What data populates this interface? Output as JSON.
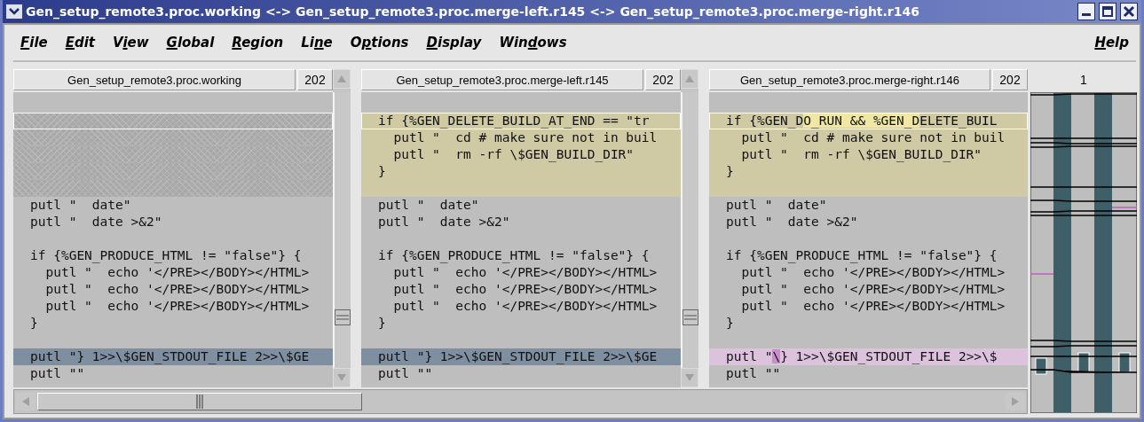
{
  "window": {
    "title": "Gen_setup_remote3.proc.working <-> Gen_setup_remote3.proc.merge-left.r145 <-> Gen_setup_remote3.proc.merge-right.r146"
  },
  "menu": [
    {
      "parts": [
        {
          "text": "F",
          "underlined": true
        },
        {
          "text": "ile",
          "underlined": false
        }
      ]
    },
    {
      "parts": [
        {
          "text": "E",
          "underlined": true
        },
        {
          "text": "dit",
          "underlined": false
        }
      ]
    },
    {
      "parts": [
        {
          "text": "V",
          "underlined": false
        },
        {
          "text": "i",
          "underlined": true
        },
        {
          "text": "ew",
          "underlined": false
        }
      ]
    },
    {
      "parts": [
        {
          "text": "G",
          "underlined": true
        },
        {
          "text": "lobal",
          "underlined": false
        }
      ]
    },
    {
      "parts": [
        {
          "text": "R",
          "underlined": true
        },
        {
          "text": "egion",
          "underlined": false
        }
      ]
    },
    {
      "parts": [
        {
          "text": "Li",
          "underlined": false
        },
        {
          "text": "n",
          "underlined": true
        },
        {
          "text": "e",
          "underlined": false
        }
      ]
    },
    {
      "parts": [
        {
          "text": "O",
          "underlined": false
        },
        {
          "text": "p",
          "underlined": true
        },
        {
          "text": "tions",
          "underlined": false
        }
      ]
    },
    {
      "parts": [
        {
          "text": "D",
          "underlined": true
        },
        {
          "text": "isplay",
          "underlined": false
        }
      ]
    },
    {
      "parts": [
        {
          "text": "Win",
          "underlined": false
        },
        {
          "text": "d",
          "underlined": true
        },
        {
          "text": "ows",
          "underlined": false
        }
      ]
    }
  ],
  "help_menu": {
    "parts": [
      {
        "text": "H",
        "underlined": true
      },
      {
        "text": "elp",
        "underlined": false
      }
    ]
  },
  "panes": [
    {
      "file": "Gen_setup_remote3.proc.working",
      "line_count": "202",
      "lines": [
        {
          "kind": "plain"
        },
        {
          "kind": "missing",
          "current": true
        },
        {
          "kind": "missing"
        },
        {
          "kind": "missing"
        },
        {
          "kind": "missing"
        },
        {
          "kind": "missing"
        },
        {
          "kind": "plain",
          "text": "putl \"  date\""
        },
        {
          "kind": "plain",
          "text": "putl \"  date >&2\""
        },
        {
          "kind": "plain"
        },
        {
          "kind": "plain",
          "text": "if {%GEN_PRODUCE_HTML != \"false\"} {"
        },
        {
          "kind": "plain",
          "text": "  putl \"  echo '</PRE></BODY></HTML>"
        },
        {
          "kind": "plain",
          "text": "  putl \"  echo '</PRE></BODY></HTML>"
        },
        {
          "kind": "plain",
          "text": "  putl \"  echo '</PRE></BODY></HTML>"
        },
        {
          "kind": "plain",
          "text": "}"
        },
        {
          "kind": "plain"
        },
        {
          "kind": "diff",
          "text": "putl \"} 1>>\\$GEN_STDOUT_FILE 2>>\\$GE"
        },
        {
          "kind": "plain",
          "text": "putl \"\""
        }
      ]
    },
    {
      "file": "Gen_setup_remote3.proc.merge-left.r145",
      "line_count": "202",
      "lines": [
        {
          "kind": "plain"
        },
        {
          "kind": "changed",
          "current": true,
          "text": "if {%GEN_DELETE_BUILD_AT_END == \"tr"
        },
        {
          "kind": "changed",
          "text": "  putl \"  cd # make sure not in buil"
        },
        {
          "kind": "changed",
          "text": "  putl \"  rm -rf \\$GEN_BUILD_DIR\""
        },
        {
          "kind": "changed",
          "text": "}"
        },
        {
          "kind": "changed"
        },
        {
          "kind": "plain",
          "text": "putl \"  date\""
        },
        {
          "kind": "plain",
          "text": "putl \"  date >&2\""
        },
        {
          "kind": "plain"
        },
        {
          "kind": "plain",
          "text": "if {%GEN_PRODUCE_HTML != \"false\"} {"
        },
        {
          "kind": "plain",
          "text": "  putl \"  echo '</PRE></BODY></HTML>"
        },
        {
          "kind": "plain",
          "text": "  putl \"  echo '</PRE></BODY></HTML>"
        },
        {
          "kind": "plain",
          "text": "  putl \"  echo '</PRE></BODY></HTML>"
        },
        {
          "kind": "plain",
          "text": "}"
        },
        {
          "kind": "plain"
        },
        {
          "kind": "diff",
          "text": "putl \"} 1>>\\$GEN_STDOUT_FILE 2>>\\$GE"
        },
        {
          "kind": "plain",
          "text": "putl \"\""
        }
      ]
    },
    {
      "file": "Gen_setup_remote3.proc.merge-right.r146",
      "line_count": "202",
      "lines": [
        {
          "kind": "plain"
        },
        {
          "kind": "changed",
          "current": true,
          "parts": [
            {
              "text": "if {%GEN_D",
              "marked": false
            },
            {
              "text": "O_RUN && %GEN_D",
              "marked": true
            },
            {
              "text": "ELETE_BUIL",
              "marked": false
            }
          ]
        },
        {
          "kind": "changed",
          "text": "  putl \"  cd # make sure not in buil"
        },
        {
          "kind": "changed",
          "text": "  putl \"  rm -rf \\$GEN_BUILD_DIR\""
        },
        {
          "kind": "changed",
          "text": "}"
        },
        {
          "kind": "changed"
        },
        {
          "kind": "plain",
          "text": "putl \"  date\""
        },
        {
          "kind": "plain",
          "text": "putl \"  date >&2\""
        },
        {
          "kind": "plain"
        },
        {
          "kind": "plain",
          "text": "if {%GEN_PRODUCE_HTML != \"false\"} {"
        },
        {
          "kind": "plain",
          "text": "  putl \"  echo '</PRE></BODY></HTML>"
        },
        {
          "kind": "plain",
          "text": "  putl \"  echo '</PRE></BODY></HTML>"
        },
        {
          "kind": "plain",
          "text": "  putl \"  echo '</PRE></BODY></HTML>"
        },
        {
          "kind": "plain",
          "text": "}"
        },
        {
          "kind": "plain"
        },
        {
          "kind": "conflict",
          "parts": [
            {
              "text": "putl \"",
              "marked": false
            },
            {
              "text": "\\",
              "marked": true
            },
            {
              "text": "} 1>>\\$GEN_STDOUT_FILE 2>>\\$",
              "marked": false
            }
          ]
        },
        {
          "kind": "plain",
          "text": "putl \"\""
        }
      ]
    }
  ],
  "map": {
    "label": "1"
  }
}
